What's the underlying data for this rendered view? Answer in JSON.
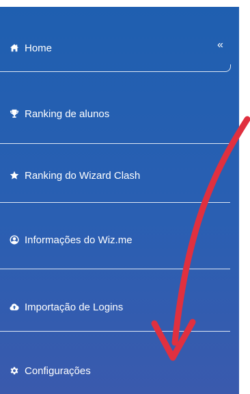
{
  "sidebar": {
    "collapse_glyph": "«",
    "items": [
      {
        "label": "Home",
        "icon": "home-icon"
      },
      {
        "label": "Ranking de alunos",
        "icon": "trophy-icon"
      },
      {
        "label": "Ranking do Wizard Clash",
        "icon": "star-icon"
      },
      {
        "label": "Informações do Wiz.me",
        "icon": "user-circle-icon"
      },
      {
        "label": "Importação de Logins",
        "icon": "cloud-upload-icon"
      },
      {
        "label": "Configurações",
        "icon": "gear-icon"
      }
    ]
  },
  "colors": {
    "sidebar_bg": "#2a5fb2",
    "arrow": "#e0303f",
    "text": "#ffffff"
  }
}
